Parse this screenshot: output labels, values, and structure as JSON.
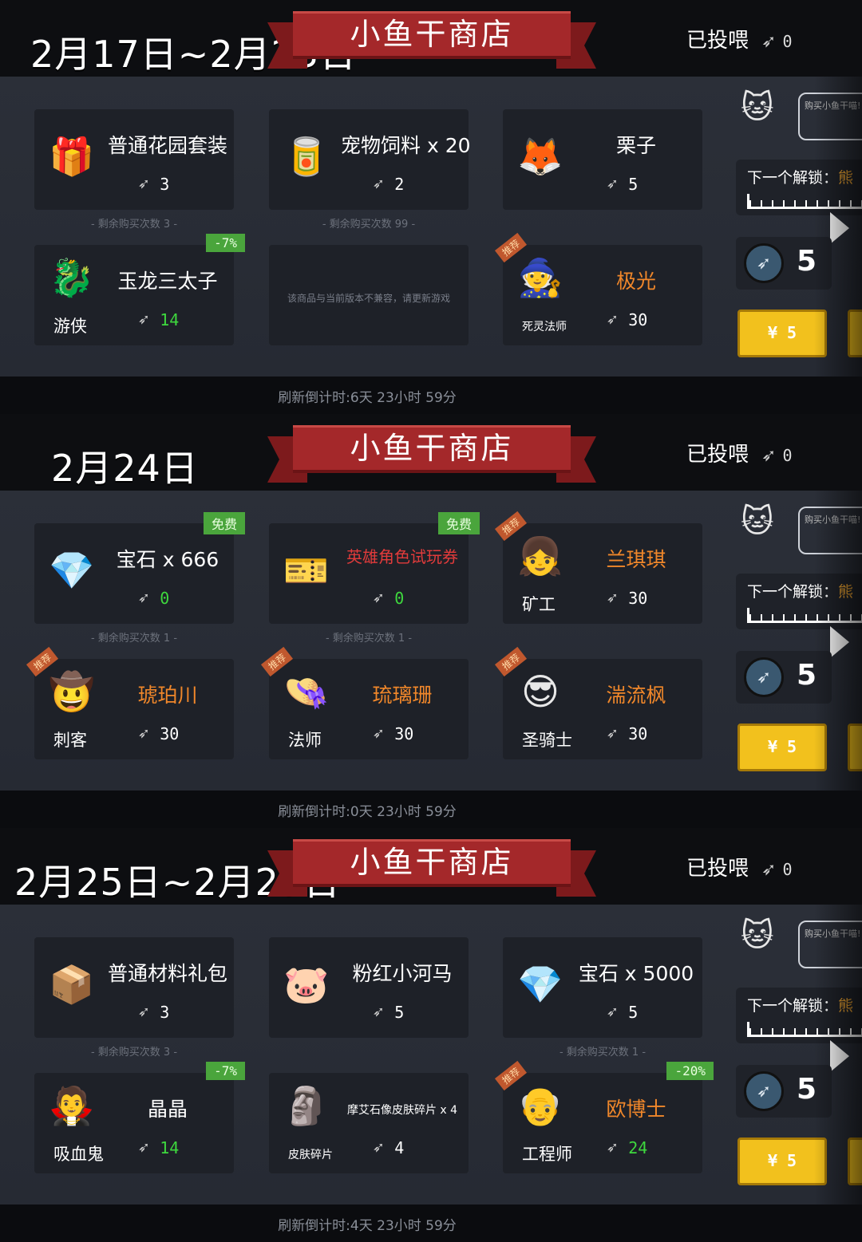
{
  "shop_title": "小鱼干商店",
  "fed_label": "已投喂",
  "fed_value": "0",
  "unlock_label": "下一个解锁：",
  "unlock_name": "熊",
  "bubble_text": "购买小鱼干喵!",
  "gem_count": "5",
  "buy_label": "¥ 5",
  "icons": {
    "fish": "fish-icon",
    "gem": "gem-icon",
    "cat": "cat-icon"
  },
  "panels": [
    {
      "date": "2月17日~2月23日",
      "refresh": "刷新倒计时:6天 23小时 59分",
      "items": [
        {
          "name": "普通花园套装",
          "price": "3",
          "icon": "🎁"
        },
        {
          "name": "宠物饲料 x 20",
          "price": "2",
          "icon": "🥫"
        },
        {
          "name": "栗子",
          "price": "5",
          "icon": "🦊"
        },
        {
          "name": "玉龙三太子",
          "price": "14",
          "role": "游侠",
          "badge": "-7%",
          "icon": "🐉",
          "green": true
        },
        {
          "note": "该商品与当前版本不兼容，请更新游戏"
        },
        {
          "name": "极光",
          "price": "30",
          "role": "死灵法师",
          "rec": "推荐",
          "icon": "🧙",
          "orange": true
        }
      ],
      "remaining": [
        "- 剩余购买次数 3 -",
        "- 剩余购买次数 99 -"
      ]
    },
    {
      "date": "2月24日",
      "refresh": "刷新倒计时:0天 23小时 59分",
      "items": [
        {
          "name": "宝石 x 666",
          "price": "0",
          "badge": "免费",
          "icon": "💎",
          "green": true
        },
        {
          "name": "英雄角色试玩券",
          "price": "0",
          "badge": "免费",
          "icon": "🎫",
          "red": true,
          "green": true
        },
        {
          "name": "兰琪琪",
          "price": "30",
          "role": "矿工",
          "rec": "推荐",
          "icon": "👧",
          "orange": true
        },
        {
          "name": "琥珀川",
          "price": "30",
          "role": "刺客",
          "rec": "推荐",
          "icon": "🤠",
          "orange": true
        },
        {
          "name": "琉璃珊",
          "price": "30",
          "role": "法师",
          "rec": "推荐",
          "icon": "👒",
          "orange": true
        },
        {
          "name": "湍流枫",
          "price": "30",
          "role": "圣骑士",
          "rec": "推荐",
          "icon": "😎",
          "orange": true
        }
      ],
      "remaining": [
        "- 剩余购买次数 1 -",
        "- 剩余购买次数 1 -"
      ]
    },
    {
      "date": "2月25日~2月29日",
      "refresh": "刷新倒计时:4天 23小时 59分",
      "items": [
        {
          "name": "普通材料礼包",
          "price": "3",
          "icon": "📦"
        },
        {
          "name": "粉红小河马",
          "price": "5",
          "icon": "🐷"
        },
        {
          "name": "宝石 x 5000",
          "price": "5",
          "icon": "💎"
        },
        {
          "name": "晶晶",
          "price": "14",
          "role": "吸血鬼",
          "badge": "-7%",
          "icon": "🧛",
          "green": true
        },
        {
          "name": "摩艾石像皮肤碎片 x 4",
          "price": "4",
          "role": "皮肤碎片",
          "icon": "🗿",
          "small": true
        },
        {
          "name": "欧博士",
          "price": "24",
          "role": "工程师",
          "badge": "-20%",
          "rec": "推荐",
          "icon": "👴",
          "orange": true,
          "green": true
        }
      ],
      "remaining": [
        "- 剩余购买次数 3 -",
        "- 剩余购买次数 1 -"
      ]
    }
  ]
}
